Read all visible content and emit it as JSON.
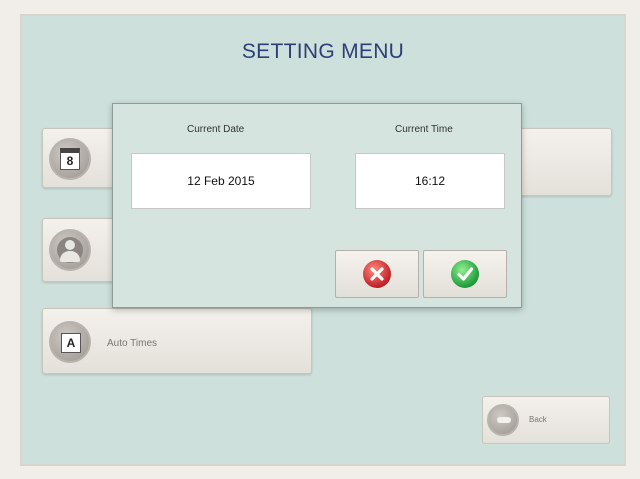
{
  "header": {
    "title": "SETTING MENU"
  },
  "menu": {
    "items": [
      {
        "id": "date-time",
        "label": "",
        "icon": "calendar-icon",
        "glyph": "8"
      },
      {
        "id": "user",
        "label": "",
        "icon": "user-icon"
      },
      {
        "id": "auto-times",
        "label": "Auto Times",
        "icon": "auto-times-icon",
        "glyph": "A"
      }
    ],
    "back_label": "Back"
  },
  "dialog": {
    "date_label": "Current Date",
    "date_value": "12 Feb 2015",
    "time_label": "Current Time",
    "time_value": "16:12",
    "cancel_icon": "cancel-icon",
    "confirm_icon": "confirm-icon"
  },
  "colors": {
    "screen_bg": "#cde0db",
    "title": "#2c3f78",
    "cancel": "#c0202a",
    "confirm": "#1f9a3a"
  }
}
